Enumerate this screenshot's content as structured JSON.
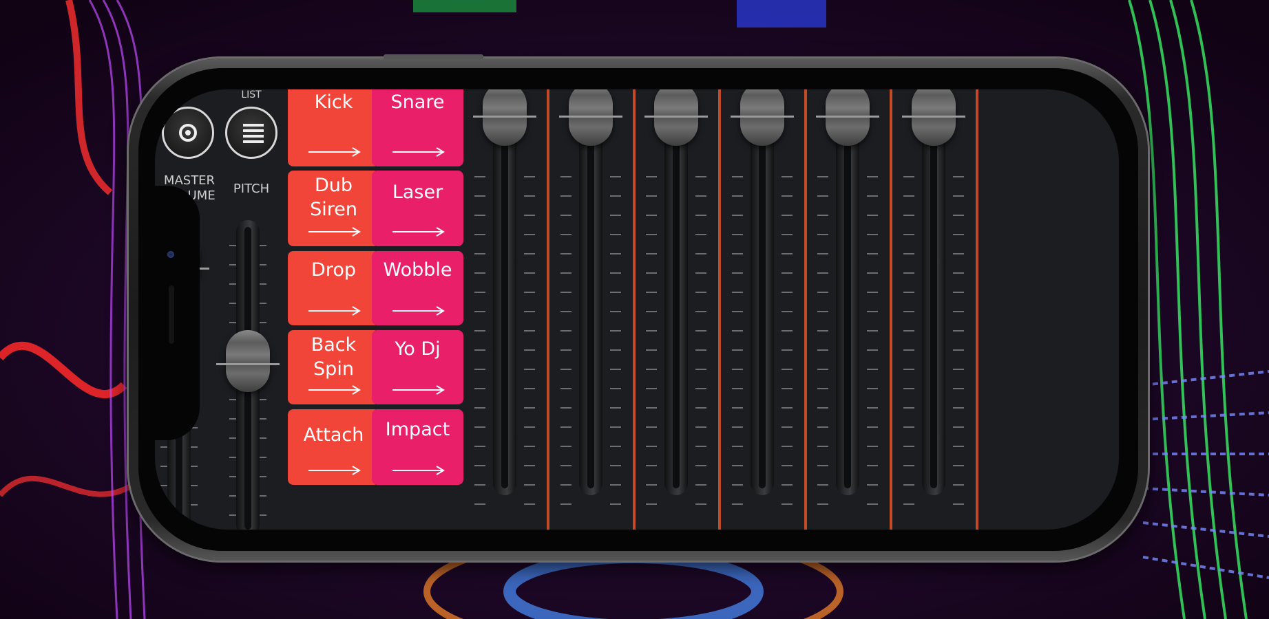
{
  "left_controls": {
    "master_label": "MASTER VOLUME",
    "pitch_label": "PITCH",
    "list_label": "LIST"
  },
  "pads": [
    {
      "label": "Kick",
      "color": "#f1453a"
    },
    {
      "label": "Snare",
      "color": "#e91f6a"
    },
    {
      "label": "Dub Siren",
      "color": "#f1453a"
    },
    {
      "label": "Laser",
      "color": "#e91f6a"
    },
    {
      "label": "Drop",
      "color": "#f1453a"
    },
    {
      "label": "Wobble",
      "color": "#e91f6a"
    },
    {
      "label": "Back Spin",
      "color": "#f1453a"
    },
    {
      "label": "Yo Dj",
      "color": "#e91f6a"
    },
    {
      "label": "Attach",
      "color": "#f1453a"
    },
    {
      "label": "Impact",
      "color": "#e91f6a"
    }
  ],
  "channel_faders": [
    {
      "level": 1.0
    },
    {
      "level": 1.0
    },
    {
      "level": 1.0
    },
    {
      "level": 1.0
    },
    {
      "level": 1.0
    },
    {
      "level": 1.0
    }
  ],
  "master_volume_level": 0.85,
  "pitch_level": 0.5,
  "colors": {
    "accent_orange": "#f1453a",
    "accent_pink": "#e91f6a",
    "divider": "#c24a27"
  }
}
